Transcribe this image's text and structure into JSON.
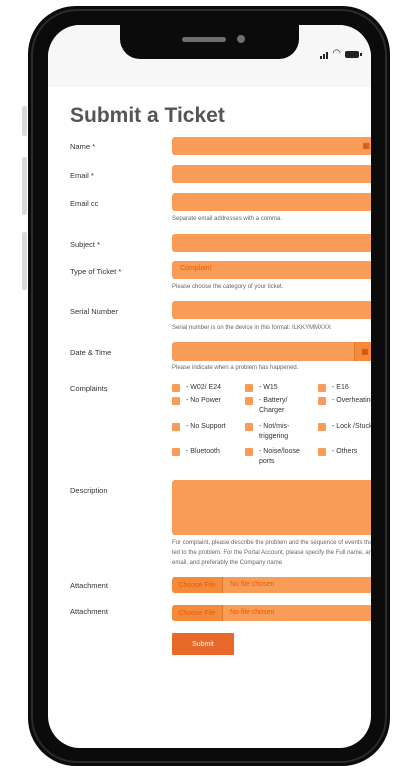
{
  "status": {
    "signal_icon": "signal-icon",
    "wifi_icon": "wifi-icon",
    "battery_icon": "battery-icon"
  },
  "form": {
    "title": "Submit a Ticket",
    "name_label": "Name *",
    "email_label": "Email *",
    "email_cc_label": "Email cc",
    "email_cc_help": "Separate email addresses with a comma.",
    "subject_label": "Subject *",
    "type_label": "Type of Ticket *",
    "type_value": "Complaint",
    "type_help": "Please choose the category of your ticket.",
    "serial_label": "Serial Number",
    "serial_help": "Serial number is on the device in this format: ILKKYMMXXX",
    "date_label": "Date & Time",
    "date_help": "Please indicate when a problem has happened.",
    "complaints_label": "Complaints",
    "complaints": [
      "- W02/ E24",
      "- W15",
      "- E16",
      "- No Power",
      "- Battery/ Charger",
      "- Overheating",
      "- No Support",
      "- Not/mis-triggering",
      "- Lock /Stuck",
      "- Bluetooth",
      "- Noise/loose ports",
      "- Others"
    ],
    "description_label": "Description",
    "description_help": "For complaint, please describe the problem and the sequence of events that led to the problem. For the Portal Account, please specify the Full name, and email, and preferably the Company name",
    "attachment_label_1": "Attachment",
    "attachment_label_2": "Attachment",
    "choose_file": "Choose File",
    "no_file": "No file chosen",
    "submit_label": "Submit"
  },
  "colors": {
    "field": "#f99c58",
    "accent": "#e8682a",
    "title": "#555555"
  }
}
